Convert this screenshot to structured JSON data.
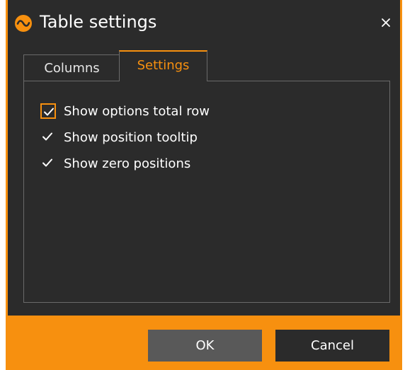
{
  "window": {
    "title": "Table settings",
    "icon": "app-logo-icon",
    "accent_color": "#f7900f",
    "background_color": "#2b2b2b"
  },
  "tabs": [
    {
      "label": "Columns",
      "active": false
    },
    {
      "label": "Settings",
      "active": true
    }
  ],
  "settings": {
    "options": [
      {
        "label": "Show options total row",
        "checked": true
      },
      {
        "label": "Show position tooltip",
        "checked": true
      },
      {
        "label": "Show zero positions",
        "checked": true
      }
    ]
  },
  "buttons": {
    "ok_label": "OK",
    "cancel_label": "Cancel"
  }
}
